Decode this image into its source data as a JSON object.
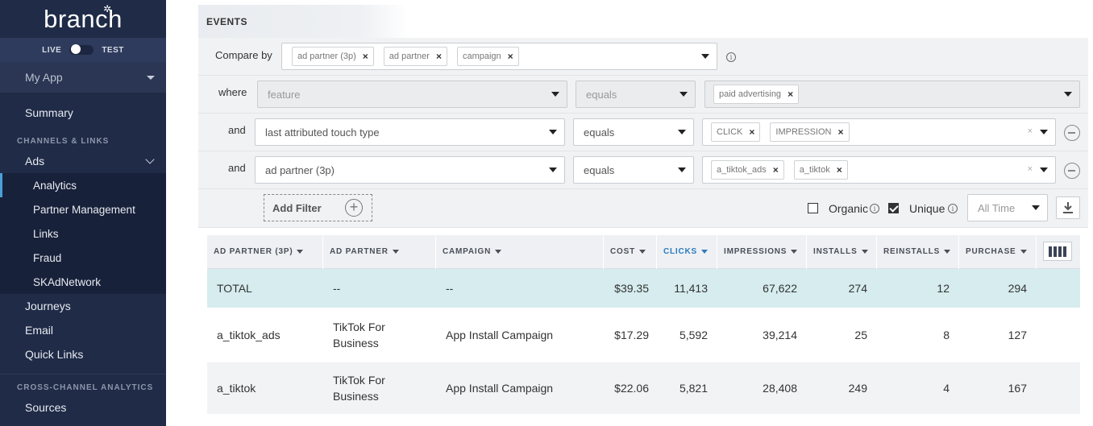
{
  "sidebar": {
    "logo": "branch",
    "env": {
      "live": "LIVE",
      "test": "TEST"
    },
    "app": "My App",
    "summary": "Summary",
    "section_channels": "CHANNELS & LINKS",
    "ads": "Ads",
    "ads_items": [
      "Analytics",
      "Partner Management",
      "Links",
      "Fraud",
      "SKAdNetwork"
    ],
    "journeys": "Journeys",
    "email": "Email",
    "quick_links": "Quick Links",
    "section_cross": "CROSS-CHANNEL ANALYTICS",
    "sources": "Sources"
  },
  "events": {
    "title": "EVENTS",
    "compare_by_label": "Compare by",
    "compare_chips": [
      "ad partner (3p)",
      "ad partner",
      "campaign"
    ],
    "rows": [
      {
        "label": "where",
        "field": "feature",
        "op": "equals",
        "chips": [
          "paid advertising"
        ]
      },
      {
        "label": "and",
        "field": "last attributed touch type",
        "op": "equals",
        "chips": [
          "CLICK",
          "IMPRESSION"
        ]
      },
      {
        "label": "and",
        "field": "ad partner (3p)",
        "op": "equals",
        "chips": [
          "a_tiktok_ads",
          "a_tiktok"
        ]
      }
    ],
    "add_filter": "Add Filter",
    "organic": "Organic",
    "unique": "Unique",
    "time_placeholder": "All Time"
  },
  "table": {
    "headers": [
      "AD PARTNER (3P)",
      "AD PARTNER",
      "CAMPAIGN",
      "COST",
      "CLICKS",
      "IMPRESSIONS",
      "INSTALLS",
      "REINSTALLS",
      "PURCHASE"
    ],
    "rows": [
      [
        "TOTAL",
        "--",
        "--",
        "$39.35",
        "11,413",
        "67,622",
        "274",
        "12",
        "294"
      ],
      [
        "a_tiktok_ads",
        "TikTok For Business",
        "App Install Campaign",
        "$17.29",
        "5,592",
        "39,214",
        "25",
        "8",
        "127"
      ],
      [
        "a_tiktok",
        "TikTok For Business",
        "App Install Campaign",
        "$22.06",
        "5,821",
        "28,408",
        "249",
        "4",
        "167"
      ]
    ]
  },
  "colors": {
    "sidebar": "#1f2b47",
    "accent": "#2b7bc0",
    "total_row": "#d6ecee",
    "alt_row": "#f2f3f5"
  },
  "icons": [
    "info-icon",
    "dropdown-caret-icon",
    "remove-filter-icon",
    "add-icon",
    "download-icon",
    "columns-icon"
  ]
}
